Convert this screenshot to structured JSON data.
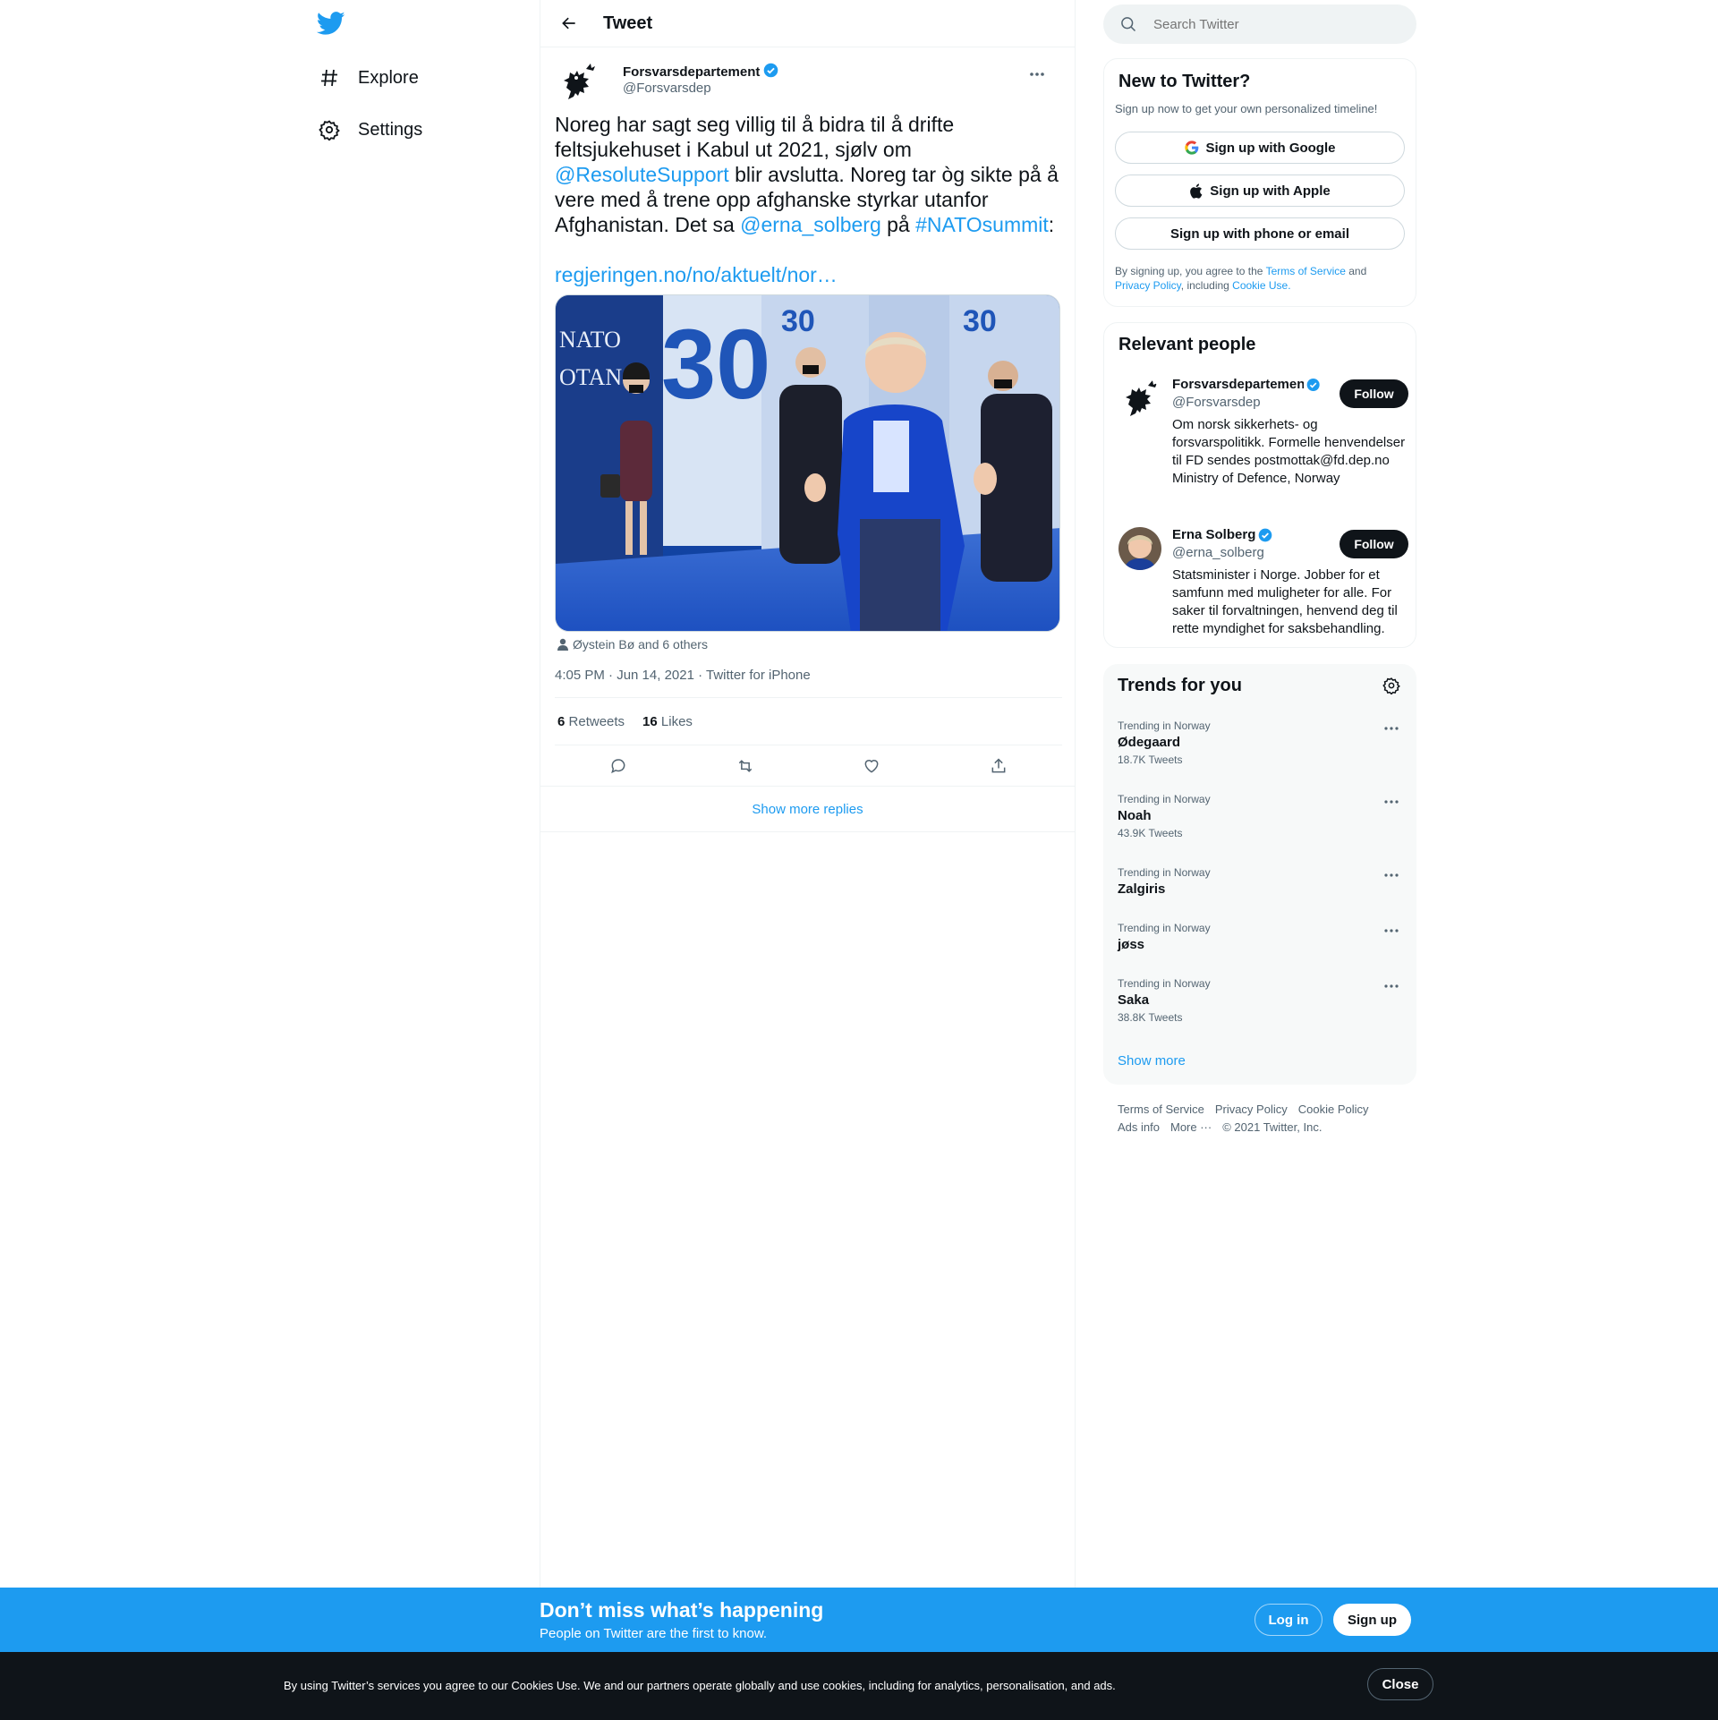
{
  "colors": {
    "accent": "#1d9bf0",
    "text": "#0f1419",
    "muted": "#536471",
    "border": "#eff3f4"
  },
  "nav": {
    "logo_icon": "twitter-bird-icon",
    "items": [
      {
        "label": "Explore",
        "icon": "hashtag-icon"
      },
      {
        "label": "Settings",
        "icon": "gear-icon"
      }
    ]
  },
  "header": {
    "title": "Tweet"
  },
  "tweet": {
    "author_name": "Forsvarsdepartement",
    "author_handle": "@Forsvarsdep",
    "text_parts": {
      "p1": "Noreg har sagt seg villig til å bidra til å drifte feltsjukehuset i Kabul ut 2021, sjølv om ",
      "m1": "@ResoluteSupport",
      "p2": " blir avslutta. Noreg tar òg sikte på å vere med å trene opp afghanske styrkar utanfor Afghanistan. Det sa ",
      "m2": "@erna_solberg",
      "p3": " på ",
      "h1": "#NATOsummit",
      "p4": ":"
    },
    "url": "regjeringen.no/no/aktuelt/nor…",
    "tagged": "Øystein Bø and 6 others",
    "timestamp": "4:05 PM · Jun 14, 2021 · Twitter for iPhone",
    "retweets": {
      "count": "6",
      "label": "Retweets"
    },
    "likes": {
      "count": "16",
      "label": "Likes"
    },
    "show_more_replies": "Show more replies"
  },
  "search": {
    "placeholder": "Search Twitter"
  },
  "new_to_twitter": {
    "title": "New to Twitter?",
    "subtitle": "Sign up now to get your own personalized timeline!",
    "google": "Sign up with Google",
    "apple": "Sign up with Apple",
    "phone": "Sign up with phone or email",
    "legal": {
      "a": "By signing up, you agree to the ",
      "tos": "Terms of Service",
      "b": " and ",
      "privacy": "Privacy Policy",
      "c": ", including ",
      "cookie": "Cookie Use",
      "d": "."
    }
  },
  "relevant_people": {
    "title": "Relevant people",
    "people": [
      {
        "name": "Forsvarsdepartement",
        "handle": "@Forsvarsdep",
        "bio": "Om norsk sikkerhets- og forsvarspolitikk. Formelle henvendelser til FD sendes postmottak@fd.dep.no Ministry of Defence, Norway",
        "follow": "Follow"
      },
      {
        "name": "Erna Solberg",
        "handle": "@erna_solberg",
        "bio": "Statsminister i Norge. Jobber for et samfunn med muligheter for alle. For saker til forvaltningen, henvend deg til rette myndighet for saksbehandling.",
        "follow": "Follow"
      }
    ]
  },
  "trends": {
    "title": "Trends for you",
    "items": [
      {
        "context": "Trending in Norway",
        "name": "Ødegaard",
        "count": "18.7K Tweets"
      },
      {
        "context": "Trending in Norway",
        "name": "Noah",
        "count": "43.9K Tweets"
      },
      {
        "context": "Trending in Norway",
        "name": "Zalgiris",
        "count": ""
      },
      {
        "context": "Trending in Norway",
        "name": "jøss",
        "count": ""
      },
      {
        "context": "Trending in Norway",
        "name": "Saka",
        "count": "38.8K Tweets"
      }
    ],
    "show_more": "Show more"
  },
  "footer": {
    "links": [
      "Terms of Service",
      "Privacy Policy",
      "Cookie Policy",
      "Ads info",
      "More ···"
    ],
    "copyright": "© 2021 Twitter, Inc."
  },
  "banner": {
    "title": "Don’t miss what’s happening",
    "subtitle": "People on Twitter are the first to know.",
    "login": "Log in",
    "signup": "Sign up"
  },
  "cookie": {
    "text": "By using Twitter’s services you agree to our Cookies Use. We and our partners operate globally and use cookies, including for analytics, personalisation, and ads.",
    "close": "Close"
  }
}
